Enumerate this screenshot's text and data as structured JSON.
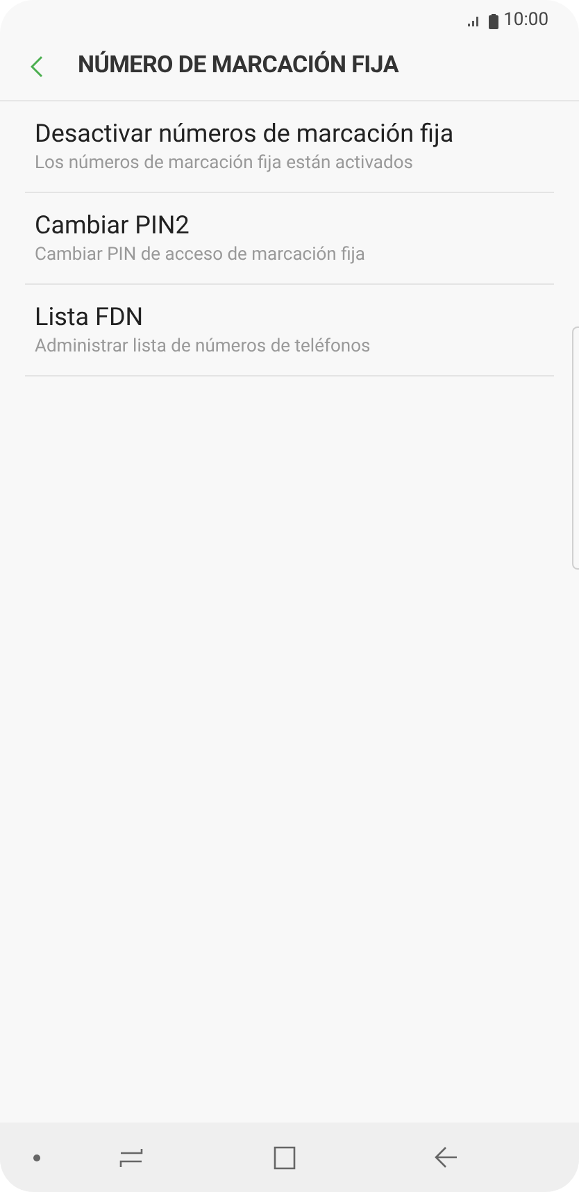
{
  "status_bar": {
    "time": "10:00"
  },
  "header": {
    "title": "NÚMERO DE MARCACIÓN FIJA"
  },
  "items": [
    {
      "title": "Desactivar números de marcación fija",
      "subtitle": "Los números de marcación fija están activados"
    },
    {
      "title": "Cambiar PIN2",
      "subtitle": "Cambiar PIN de acceso de marcación fija"
    },
    {
      "title": "Lista FDN",
      "subtitle": "Administrar lista de números de teléfonos"
    }
  ]
}
